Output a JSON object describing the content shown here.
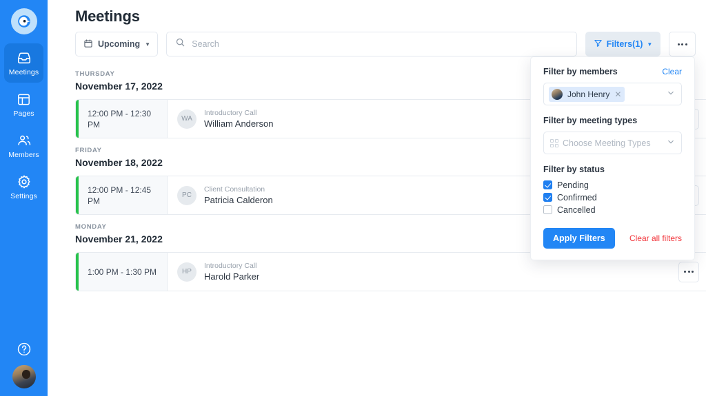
{
  "sidebar": {
    "logo_name": "app-logo",
    "items": [
      {
        "label": "Meetings",
        "icon": "inbox-icon",
        "active": true
      },
      {
        "label": "Pages",
        "icon": "layout-icon",
        "active": false
      },
      {
        "label": "Members",
        "icon": "people-icon",
        "active": false
      },
      {
        "label": "Settings",
        "icon": "gear-icon",
        "active": false
      }
    ],
    "help_icon": "help-circle-icon",
    "avatar": "user-avatar"
  },
  "header": {
    "title": "Meetings"
  },
  "toolbar": {
    "upcoming_label": "Upcoming",
    "upcoming_icon": "calendar-icon",
    "search_placeholder": "Search",
    "search_value": "",
    "search_icon": "search-icon",
    "filters_label": "Filters(1)",
    "filters_icon": "funnel-icon",
    "more_icon": "ellipsis-icon"
  },
  "groups": [
    {
      "weekday": "THURSDAY",
      "date": "November 17, 2022",
      "meetings": [
        {
          "time": "12:00 PM - 12:30 PM",
          "initials": "WA",
          "type": "Introductory Call",
          "name": "William Anderson",
          "accent": "#27c24c"
        }
      ]
    },
    {
      "weekday": "FRIDAY",
      "date": "November 18, 2022",
      "meetings": [
        {
          "time": "12:00 PM - 12:45 PM",
          "initials": "PC",
          "type": "Client Consultation",
          "name": "Patricia Calderon",
          "accent": "#27c24c"
        }
      ]
    },
    {
      "weekday": "MONDAY",
      "date": "November 21, 2022",
      "meetings": [
        {
          "time": "1:00 PM - 1:30 PM",
          "initials": "HP",
          "type": "Introductory Call",
          "name": "Harold Parker",
          "accent": "#27c24c"
        }
      ]
    }
  ],
  "filter_panel": {
    "members_label": "Filter by members",
    "clear_label": "Clear",
    "selected_member": "John Henry",
    "member_remove_icon": "close-icon",
    "types_label": "Filter by meeting types",
    "types_placeholder": "Choose Meeting Types",
    "types_icon": "grid-icon",
    "status_label": "Filter by status",
    "statuses": [
      {
        "label": "Pending",
        "checked": true
      },
      {
        "label": "Confirmed",
        "checked": true
      },
      {
        "label": "Cancelled",
        "checked": false
      }
    ],
    "apply_label": "Apply Filters",
    "clear_all_label": "Clear all filters"
  },
  "colors": {
    "brand_blue": "#2286f5",
    "accent_green": "#27c24c",
    "danger_red": "#f2363c",
    "filters_bg": "#e6ecf2"
  }
}
